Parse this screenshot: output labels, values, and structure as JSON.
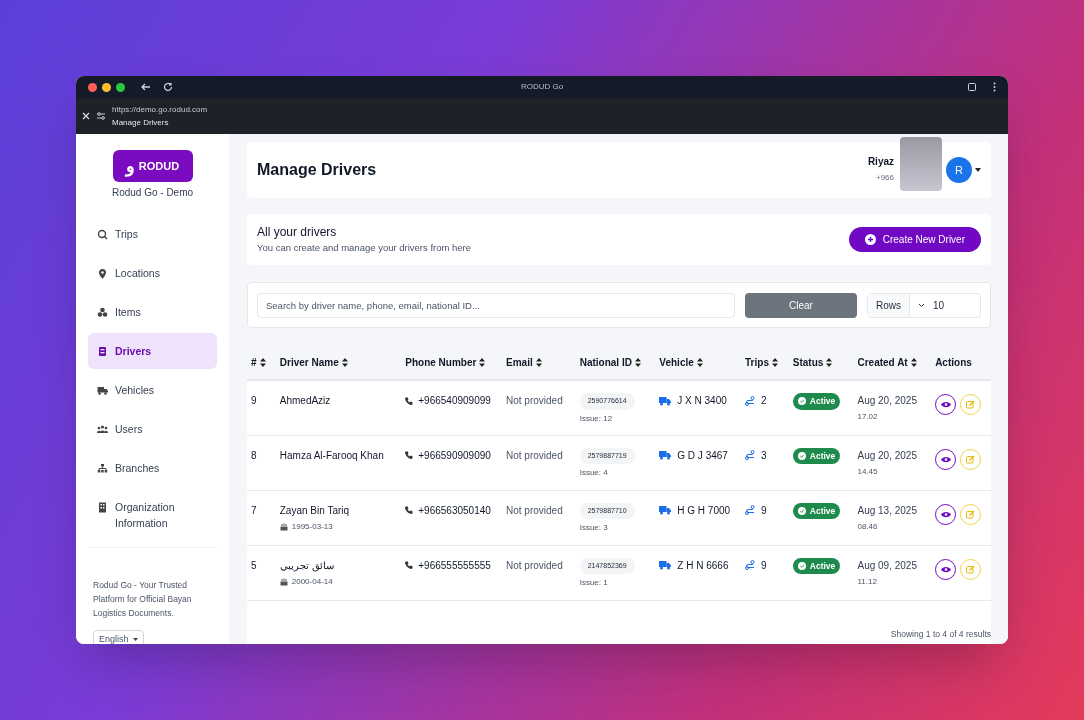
{
  "browser": {
    "title": "RODUD Go",
    "url": "https://demo.go.rodud.com",
    "tab_title": "Manage Drivers"
  },
  "sidebar": {
    "logo_mark": "و",
    "brand": "RODUD",
    "app_name": "Rodud Go - Demo",
    "items": [
      {
        "label": "Trips",
        "selected": false
      },
      {
        "label": "Locations",
        "selected": false
      },
      {
        "label": "Items",
        "selected": false
      },
      {
        "label": "Drivers",
        "selected": true
      },
      {
        "label": "Vehicles",
        "selected": false
      },
      {
        "label": "Users",
        "selected": false
      },
      {
        "label": "Branches",
        "selected": false
      },
      {
        "label": "Organization Information",
        "selected": false
      }
    ],
    "tagline": "Rodud Go - Your Trusted Platform for Official Bayan Logistics Documents.",
    "language": "English"
  },
  "header": {
    "title": "Manage Drivers",
    "user_name": "Riyaz",
    "user_phone": "+966",
    "avatar": "R"
  },
  "intro": {
    "title": "All your drivers",
    "subtitle": "You can create and manage your drivers from here",
    "create_button": "Create New Driver"
  },
  "filters": {
    "search_placeholder": "Search by driver name, phone, email, national ID...",
    "clear_button": "Clear",
    "rows_label": "Rows",
    "rows_value": "10"
  },
  "table": {
    "columns": [
      "#",
      "Driver Name",
      "Phone Number",
      "Email",
      "National ID",
      "Vehicle",
      "Trips",
      "Status",
      "Created At",
      "Actions"
    ],
    "rows": [
      {
        "number": "9",
        "name": "AhmedAziz",
        "phone": "+966540909099",
        "email": "Not provided",
        "national_id": "2590776614",
        "issue": "Issue: 12",
        "vehicle": "J X N 3400",
        "trips": "2",
        "status": "Active",
        "date": "Aug 20, 2025",
        "time": "17.02"
      },
      {
        "number": "8",
        "name": "Hamza Al-Farooq Khan",
        "phone": "+966590909090",
        "email": "Not provided",
        "national_id": "2579887719",
        "issue": "Issue: 4",
        "vehicle": "G D J 3467",
        "trips": "3",
        "status": "Active",
        "date": "Aug 20, 2025",
        "time": "14.45"
      },
      {
        "number": "7",
        "name": "Zayan Bin Tariq",
        "birth_date": "1995-03-13",
        "phone": "+966563050140",
        "email": "Not provided",
        "national_id": "2579887710",
        "issue": "Issue: 3",
        "vehicle": "H G H 7000",
        "trips": "9",
        "status": "Active",
        "date": "Aug 13, 2025",
        "time": "08.46"
      },
      {
        "number": "5",
        "name": "سائق تجريبي",
        "birth_date": "2000-04-14",
        "phone": "+966555555555",
        "email": "Not provided",
        "national_id": "2147852369",
        "issue": "Issue: 1",
        "vehicle": "Z H N 6666",
        "trips": "9",
        "status": "Active",
        "date": "Aug 09, 2025",
        "time": "11.12"
      }
    ],
    "summary": "Showing 1 to 4 of 4 results"
  }
}
